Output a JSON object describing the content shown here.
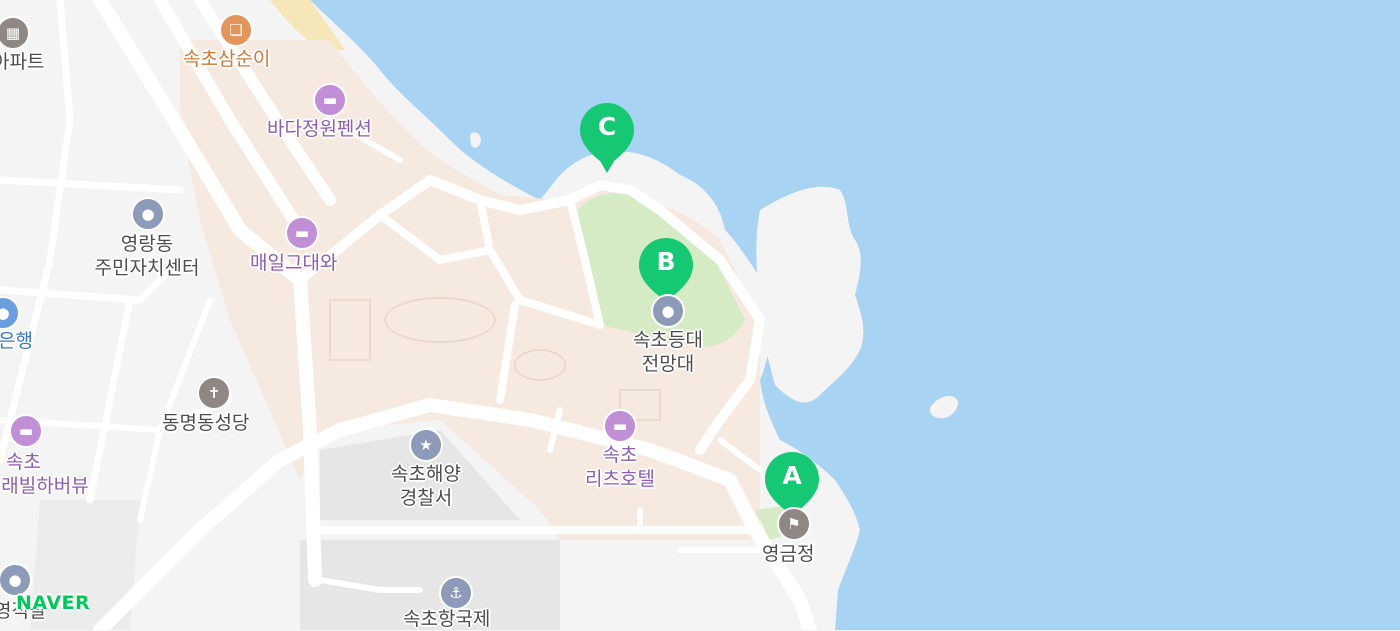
{
  "map": {
    "colors": {
      "sea": "#a8d3f2",
      "land": "#f4f4f4",
      "district": "#f6e9e0",
      "park": "#d5ebc5",
      "road": "#ffffff",
      "marker": "#16c874"
    },
    "markers": [
      {
        "id": "A",
        "label": "A"
      },
      {
        "id": "B",
        "label": "B"
      },
      {
        "id": "C",
        "label": "C"
      }
    ],
    "labels": {
      "apartment": "아파트",
      "samsuni": "속초삼순이",
      "bada_pension": "바다정원펜션",
      "community_center_1": "영랑동",
      "community_center_2": "주민자치센터",
      "maeil": "매일그대와",
      "bank": "은행",
      "church": "동명동성당",
      "sokcho_harbi_1": "속초",
      "sokcho_harbi_2": "래빌하버뷰",
      "police_1": "속초해양",
      "police_2": "경찰서",
      "resort_1": "속초",
      "resort_2": "리츠호텔",
      "lighthouse_1": "속초등대",
      "lighthouse_2": "전망대",
      "yeonggeumjeong": "영금정",
      "port": "속초항국제",
      "bottom_left": "영적발"
    },
    "icons": [
      "apartment-icon",
      "restaurant-icon",
      "lodging-icon",
      "public-office-icon",
      "bank-icon",
      "church-icon",
      "police-icon",
      "ferry-icon",
      "pavilion-icon"
    ],
    "logo": "NAVER"
  }
}
